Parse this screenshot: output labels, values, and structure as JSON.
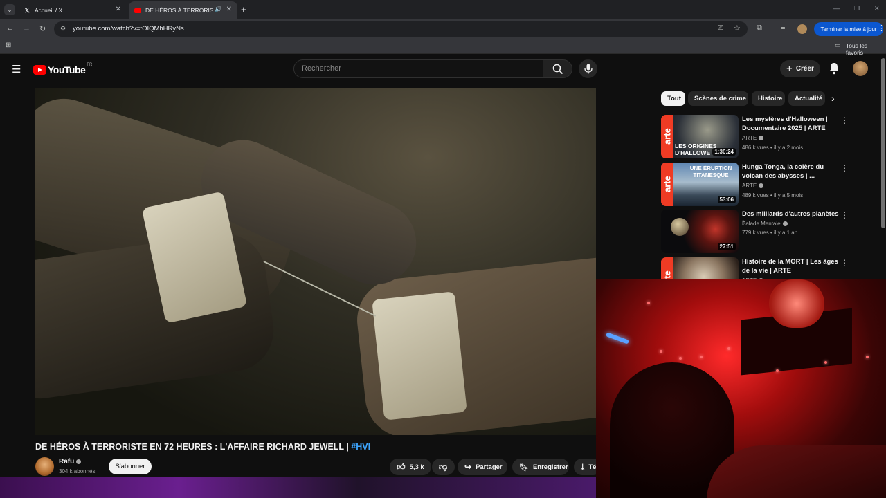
{
  "browser": {
    "tabs": [
      {
        "label": "Accueil / X",
        "icon": "x-logo-icon",
        "active": false
      },
      {
        "label": "DE HÉROS À TERRORISTE E",
        "icon": "youtube-icon",
        "active": true
      }
    ],
    "url": "youtube.com/watch?v=tOIQMhHRyNs",
    "update_button": "Terminer la mise à jour",
    "bookmarks_label": "Tous les favoris"
  },
  "youtube": {
    "logo_text": "YouTube",
    "country_code": "FR",
    "search_placeholder": "Rechercher",
    "create_label": "Créer"
  },
  "video": {
    "title": "DE HÉROS À TERRORISTE EN 72 HEURES : L'AFFAIRE RICHARD JEWELL | ",
    "hashtag": "#HVI",
    "channel": "Rafu",
    "subscribers": "304 k abonnés",
    "subscribe_label": "S'abonner",
    "likes": "5,3 k",
    "share_label": "Partager",
    "save_label": "Enregistrer",
    "download_label": "Té"
  },
  "sidebar": {
    "chips": [
      "Tout",
      "Scènes de crime",
      "Histoire",
      "Actualité"
    ],
    "recommendations": [
      {
        "title": "Les mystères d'Halloween | Documentaire 2025 | ARTE",
        "channel": "ARTE",
        "meta": "486 k vues • il y a 2 mois",
        "duration": "1:30:24",
        "overlay": "LES ORIGINES D'HALLOWE"
      },
      {
        "title": "Hunga Tonga, la colère du volcan des abysses | ...",
        "channel": "ARTE",
        "meta": "489 k vues • il y a 5 mois",
        "duration": "53:06",
        "overlay": "UNE ÉRUPTION TITANESQUE"
      },
      {
        "title": "Des milliards d'autres planètes !",
        "channel": "Balade Mentale",
        "meta": "779 k vues • il y a 1 an",
        "duration": "27:51",
        "overlay": ""
      },
      {
        "title": "Histoire de la MORT | Les âges de la vie | ARTE",
        "channel": "ARTE",
        "meta": "",
        "duration": "",
        "overlay": ""
      }
    ]
  },
  "colors": {
    "accent": "#ff0000",
    "link": "#3ea6ff",
    "arte": "#ef3b24",
    "update": "#0b57d0"
  }
}
